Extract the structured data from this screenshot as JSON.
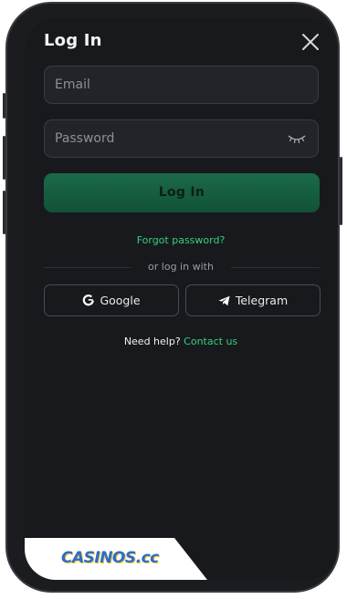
{
  "modal": {
    "title": "Log In",
    "email_placeholder": "Email",
    "password_placeholder": "Password",
    "login_label": "Log In",
    "forgot_label": "Forgot password?",
    "or_label": "or log in with",
    "google_label": "Google",
    "telegram_label": "Telegram",
    "help_label": "Need help?",
    "contact_label": "Contact us"
  },
  "watermark": {
    "text": "CASINOS.cc"
  },
  "colors": {
    "accent": "#35d07f",
    "button": "#176244",
    "background": "#18191d"
  },
  "icons": [
    "close-icon",
    "eye-closed-icon",
    "google-icon",
    "telegram-icon"
  ]
}
